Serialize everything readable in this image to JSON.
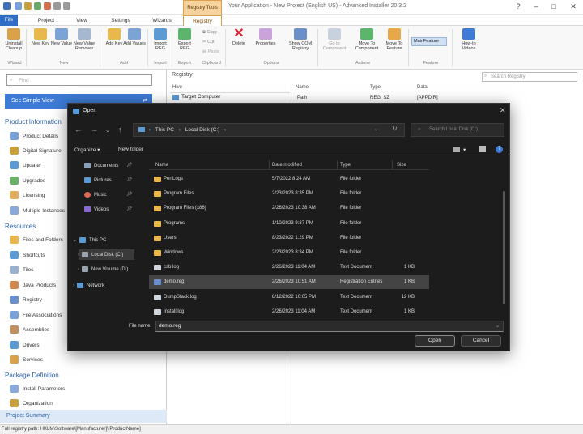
{
  "app": {
    "title": "Your Application - New Project (English US) - Advanced Installer 20.3.2",
    "context_group": "Registry Tools"
  },
  "tabs": [
    {
      "label": "File"
    },
    {
      "label": "Project"
    },
    {
      "label": "View"
    },
    {
      "label": "Settings"
    },
    {
      "label": "Wizards"
    },
    {
      "label": "Registry"
    }
  ],
  "ribbon": {
    "buttons": [
      {
        "label": "Uninstall Cleanup",
        "icon": "broom-icon"
      },
      {
        "label": "New Key",
        "icon": "folder-icon"
      },
      {
        "label": "New Value",
        "icon": "value-icon"
      },
      {
        "label": "New Value Remover",
        "icon": "value-remove-icon"
      },
      {
        "label": "Add Key",
        "icon": "folder-add-icon"
      },
      {
        "label": "Add Values",
        "icon": "values-add-icon"
      },
      {
        "label": "Import REG",
        "icon": "import-icon"
      },
      {
        "label": "Export REG",
        "icon": "export-icon"
      },
      {
        "label": "Delete",
        "icon": "delete-icon"
      },
      {
        "label": "Properties",
        "icon": "properties-icon"
      },
      {
        "label": "Show COM Registry",
        "icon": "com-icon"
      },
      {
        "label": "Go to Component",
        "icon": "goto-icon"
      },
      {
        "label": "Move To Component",
        "icon": "move-component-icon"
      },
      {
        "label": "Move To Feature",
        "icon": "move-feature-icon"
      },
      {
        "label": "How-to Videos",
        "icon": "video-icon"
      }
    ],
    "clipboard": {
      "copy": "Copy",
      "cut": "Cut",
      "paste": "Paste"
    },
    "feature_select": "MainFeature",
    "groups": [
      "Wizard",
      "New",
      "Add",
      "Import",
      "Export",
      "Clipboard",
      "Options",
      "Actions",
      "Feature"
    ]
  },
  "left": {
    "find_placeholder": "Find",
    "simple_view": "See Simple View",
    "sections": {
      "product_info": "Product Information",
      "resources": "Resources",
      "package_def": "Package Definition"
    },
    "product_items": [
      "Product Details",
      "Digital Signature",
      "Updater",
      "Upgrades",
      "Licensing",
      "Multiple Instances"
    ],
    "resource_items": [
      "Files and Folders",
      "Shortcuts",
      "Tiles",
      "Java Products",
      "Registry",
      "File Associations",
      "Assemblies",
      "Drivers",
      "Services"
    ],
    "package_items": [
      "Install Parameters",
      "Organization"
    ],
    "project_summary": "Project Summary"
  },
  "registry": {
    "title": "Registry",
    "search_placeholder": "Search Registry",
    "tree_header": "Hive",
    "tree_item": "Target Computer",
    "columns": [
      "Name",
      "Type",
      "Data"
    ],
    "row": {
      "name": "Path",
      "type": "REG_SZ",
      "data": "[APPDIR]"
    }
  },
  "status_bar": "Full registry path: HKLM\\Software\\[Manufacturer]\\[ProductName]",
  "dialog": {
    "title": "Open",
    "address": {
      "root": "This PC",
      "folder": "Local Disk (C:)"
    },
    "search_placeholder": "Search Local Disk (C:)",
    "organize": "Organize",
    "new_folder": "New folder",
    "nav": [
      {
        "label": "Documents",
        "icon": "documents-icon",
        "pinned": true
      },
      {
        "label": "Pictures",
        "icon": "pictures-icon",
        "pinned": true
      },
      {
        "label": "Music",
        "icon": "music-icon",
        "pinned": true
      },
      {
        "label": "Videos",
        "icon": "videos-icon",
        "pinned": true
      },
      {
        "label": "This PC",
        "icon": "pc-icon"
      },
      {
        "label": "Local Disk (C:)",
        "icon": "drive-icon"
      },
      {
        "label": "New Volume (D:)",
        "icon": "drive-icon"
      },
      {
        "label": "Network",
        "icon": "network-icon"
      }
    ],
    "columns": [
      "Name",
      "Date modified",
      "Type",
      "Size"
    ],
    "files": [
      {
        "name": "PerfLogs",
        "date": "5/7/2022 8:24 AM",
        "type": "File folder",
        "size": "",
        "kind": "folder"
      },
      {
        "name": "Program Files",
        "date": "2/23/2023 8:35 PM",
        "type": "File folder",
        "size": "",
        "kind": "folder"
      },
      {
        "name": "Program Files (x86)",
        "date": "2/26/2023 10:38 AM",
        "type": "File folder",
        "size": "",
        "kind": "folder"
      },
      {
        "name": "Programs",
        "date": "1/10/2023 9:37 PM",
        "type": "File folder",
        "size": "",
        "kind": "folder"
      },
      {
        "name": "Users",
        "date": "8/23/2022 1:29 PM",
        "type": "File folder",
        "size": "",
        "kind": "folder"
      },
      {
        "name": "Windows",
        "date": "2/23/2023 8:34 PM",
        "type": "File folder",
        "size": "",
        "kind": "folder"
      },
      {
        "name": "csb.log",
        "date": "2/26/2023 11:04 AM",
        "type": "Text Document",
        "size": "1 KB",
        "kind": "doc"
      },
      {
        "name": "demo.reg",
        "date": "2/26/2023 10:51 AM",
        "type": "Registration Entries",
        "size": "1 KB",
        "kind": "reg",
        "selected": true
      },
      {
        "name": "DumpStack.log",
        "date": "8/12/2022 10:05 PM",
        "type": "Text Document",
        "size": "12 KB",
        "kind": "doc"
      },
      {
        "name": "Install.log",
        "date": "2/26/2023 11:04 AM",
        "type": "Text Document",
        "size": "1 KB",
        "kind": "doc"
      }
    ],
    "file_name_label": "File name:",
    "file_name_value": "demo.reg",
    "open_label": "Open",
    "cancel_label": "Cancel"
  },
  "colors": {
    "accent": "#2f6dc6",
    "context_tab": "#f6d39e",
    "dialog_bg": "#1c1c1c",
    "folder": "#e8b84a",
    "selected_row": "#444444"
  }
}
